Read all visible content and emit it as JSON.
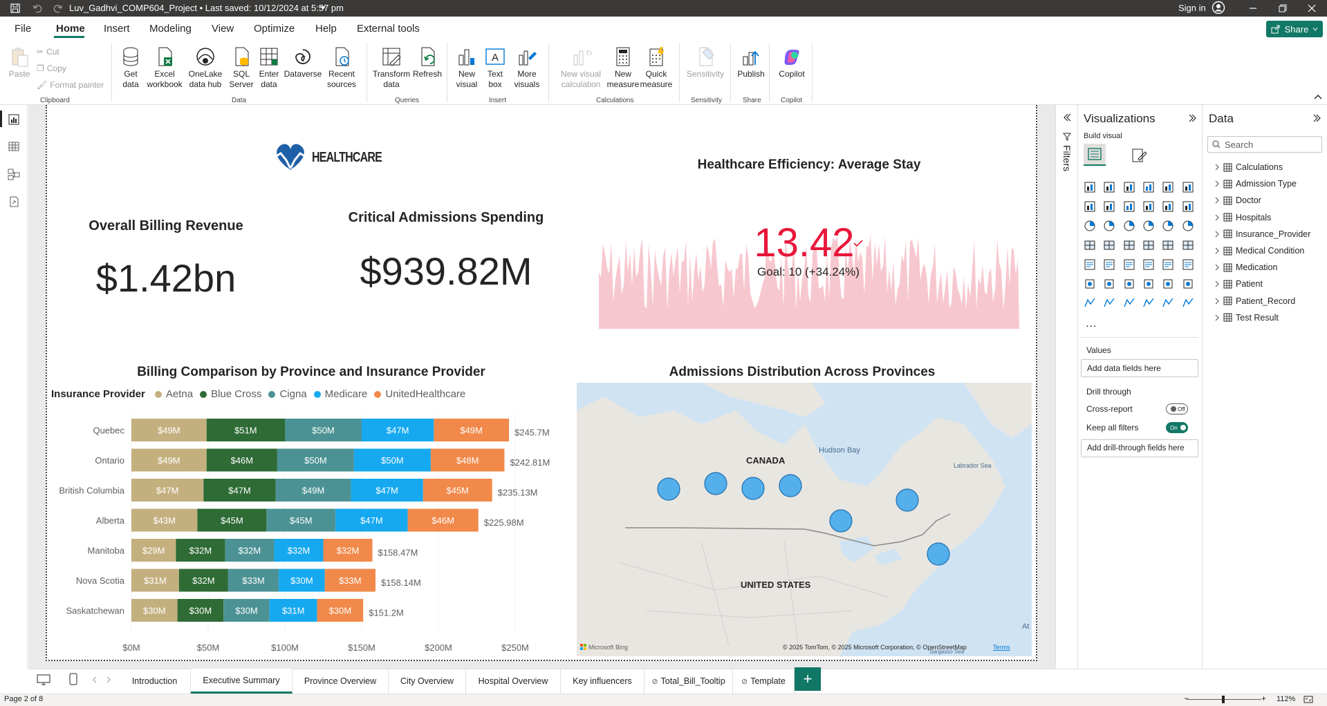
{
  "titlebar": {
    "title": "Luv_Gadhvi_COMP604_Project  •  Last saved: 10/12/2024 at 5:57 pm",
    "sign_in": "Sign in"
  },
  "menu": {
    "tabs": [
      "File",
      "Home",
      "Insert",
      "Modeling",
      "View",
      "Optimize",
      "Help",
      "External tools"
    ],
    "share": "Share"
  },
  "ribbon": {
    "clipboard": {
      "paste": "Paste",
      "cut": "Cut",
      "copy": "Copy",
      "format_painter": "Format painter",
      "group": "Clipboard"
    },
    "data": {
      "get_data": "Get data",
      "excel": "Excel workbook",
      "onelake": "OneLake data hub",
      "sql": "SQL Server",
      "enter": "Enter data",
      "dataverse": "Dataverse",
      "recent": "Recent sources",
      "group": "Data"
    },
    "queries": {
      "transform": "Transform data",
      "refresh": "Refresh",
      "group": "Queries"
    },
    "insert": {
      "new_visual": "New visual",
      "text_box": "Text box",
      "more_visuals": "More visuals",
      "group": "Insert"
    },
    "calculations": {
      "new_visual_calc": "New visual calculation",
      "new_measure": "New measure",
      "quick_measure": "Quick measure",
      "group": "Calculations"
    },
    "sensitivity": {
      "label": "Sensitivity",
      "group": "Sensitivity"
    },
    "share": {
      "publish": "Publish",
      "group": "Share"
    },
    "copilot": {
      "label": "Copilot",
      "group": "Copilot"
    }
  },
  "report": {
    "logo_text": "HEALTHCARE",
    "card1": {
      "title": "Overall Billing Revenue",
      "value": "$1.42bn"
    },
    "card2": {
      "title": "Critical Admissions Spending",
      "value": "$939.82M"
    },
    "kpi": {
      "title": "Healthcare Efficiency: Average Stay",
      "value": "13.42",
      "goal": "Goal: 10 (+34.24%)",
      "value_color": "#e8173a"
    },
    "bar_title": "Billing Comparison by Province and Insurance Provider",
    "legend_title": "Insurance Provider",
    "map": {
      "title": "Admissions Distribution Across Provinces",
      "labels": {
        "canada": "CANADA",
        "us": "UNITED STATES",
        "hudson": "Hudson Bay",
        "labrador": "Labrador Sea",
        "atlantic": "At",
        "sargasso": "Sargasso Sea"
      },
      "attribution": "© 2025 TomTom, © 2025 Microsoft Corporation, © OpenStreetMap",
      "terms": "Terms",
      "brand": "Microsoft Bing"
    }
  },
  "chart_data": {
    "type": "bar",
    "title": "Billing Comparison by Province and Insurance Provider",
    "orientation": "horizontal",
    "stacked": true,
    "categories": [
      "Quebec",
      "Ontario",
      "British Columbia",
      "Alberta",
      "Manitoba",
      "Nova Scotia",
      "Saskatchewan"
    ],
    "totals": [
      "$245.7M",
      "$242.81M",
      "$235.13M",
      "$225.98M",
      "$158.47M",
      "$158.14M",
      "$151.2M"
    ],
    "series": [
      {
        "name": "Aetna",
        "color": "#c4b07f",
        "values": [
          49,
          49,
          47,
          43,
          29,
          31,
          30
        ],
        "labels": [
          "$49M",
          "$49M",
          "$47M",
          "$43M",
          "$29M",
          "$31M",
          "$30M"
        ]
      },
      {
        "name": "Blue Cross",
        "color": "#2e6b35",
        "values": [
          51,
          46,
          47,
          45,
          32,
          32,
          30
        ],
        "labels": [
          "$51M",
          "$46M",
          "$47M",
          "$45M",
          "$32M",
          "$32M",
          "$30M"
        ]
      },
      {
        "name": "Cigna",
        "color": "#4c9294",
        "values": [
          50,
          50,
          49,
          45,
          32,
          33,
          30
        ],
        "labels": [
          "$50M",
          "$50M",
          "$49M",
          "$45M",
          "$32M",
          "$33M",
          "$30M"
        ]
      },
      {
        "name": "Medicare",
        "color": "#16a9f0",
        "values": [
          47,
          50,
          47,
          47,
          32,
          30,
          31
        ],
        "labels": [
          "$47M",
          "$50M",
          "$47M",
          "$47M",
          "$32M",
          "$30M",
          "$31M"
        ]
      },
      {
        "name": "UnitedHealthcare",
        "color": "#f0894a",
        "values": [
          49,
          48,
          45,
          46,
          32,
          33,
          30
        ],
        "labels": [
          "$49M",
          "$48M",
          "$45M",
          "$46M",
          "$32M",
          "$33M",
          "$30M"
        ]
      }
    ],
    "x_ticks": [
      "$0M",
      "$50M",
      "$100M",
      "$150M",
      "$200M",
      "$250M"
    ],
    "xlim": [
      0,
      250
    ],
    "legend": "top-left"
  },
  "panes": {
    "viz_title": "Visualizations",
    "build_visual": "Build visual",
    "values_label": "Values",
    "add_data_fields": "Add data fields here",
    "drill_through": "Drill through",
    "cross_report": "Cross-report",
    "cross_report_state": "Off",
    "keep_filters": "Keep all filters",
    "keep_filters_state": "On",
    "add_drill": "Add drill-through fields here",
    "filters": "Filters",
    "more": "...",
    "data_title": "Data",
    "search_placeholder": "Search",
    "tables": [
      "Calculations",
      "Admission Type",
      "Doctor",
      "Hospitals",
      "Insurance_Provider",
      "Medical Condition",
      "Medication",
      "Patient",
      "Patient_Record",
      "Test Result"
    ]
  },
  "pages": {
    "tabs": [
      "Introduction",
      "Executive Summary",
      "Province Overview",
      "City Overview",
      "Hospital Overview",
      "Key influencers",
      "Total_Bill_Tooltip",
      "Template"
    ],
    "add": "+"
  },
  "status": {
    "page": "Page 2 of 8",
    "zoom": "112%"
  }
}
